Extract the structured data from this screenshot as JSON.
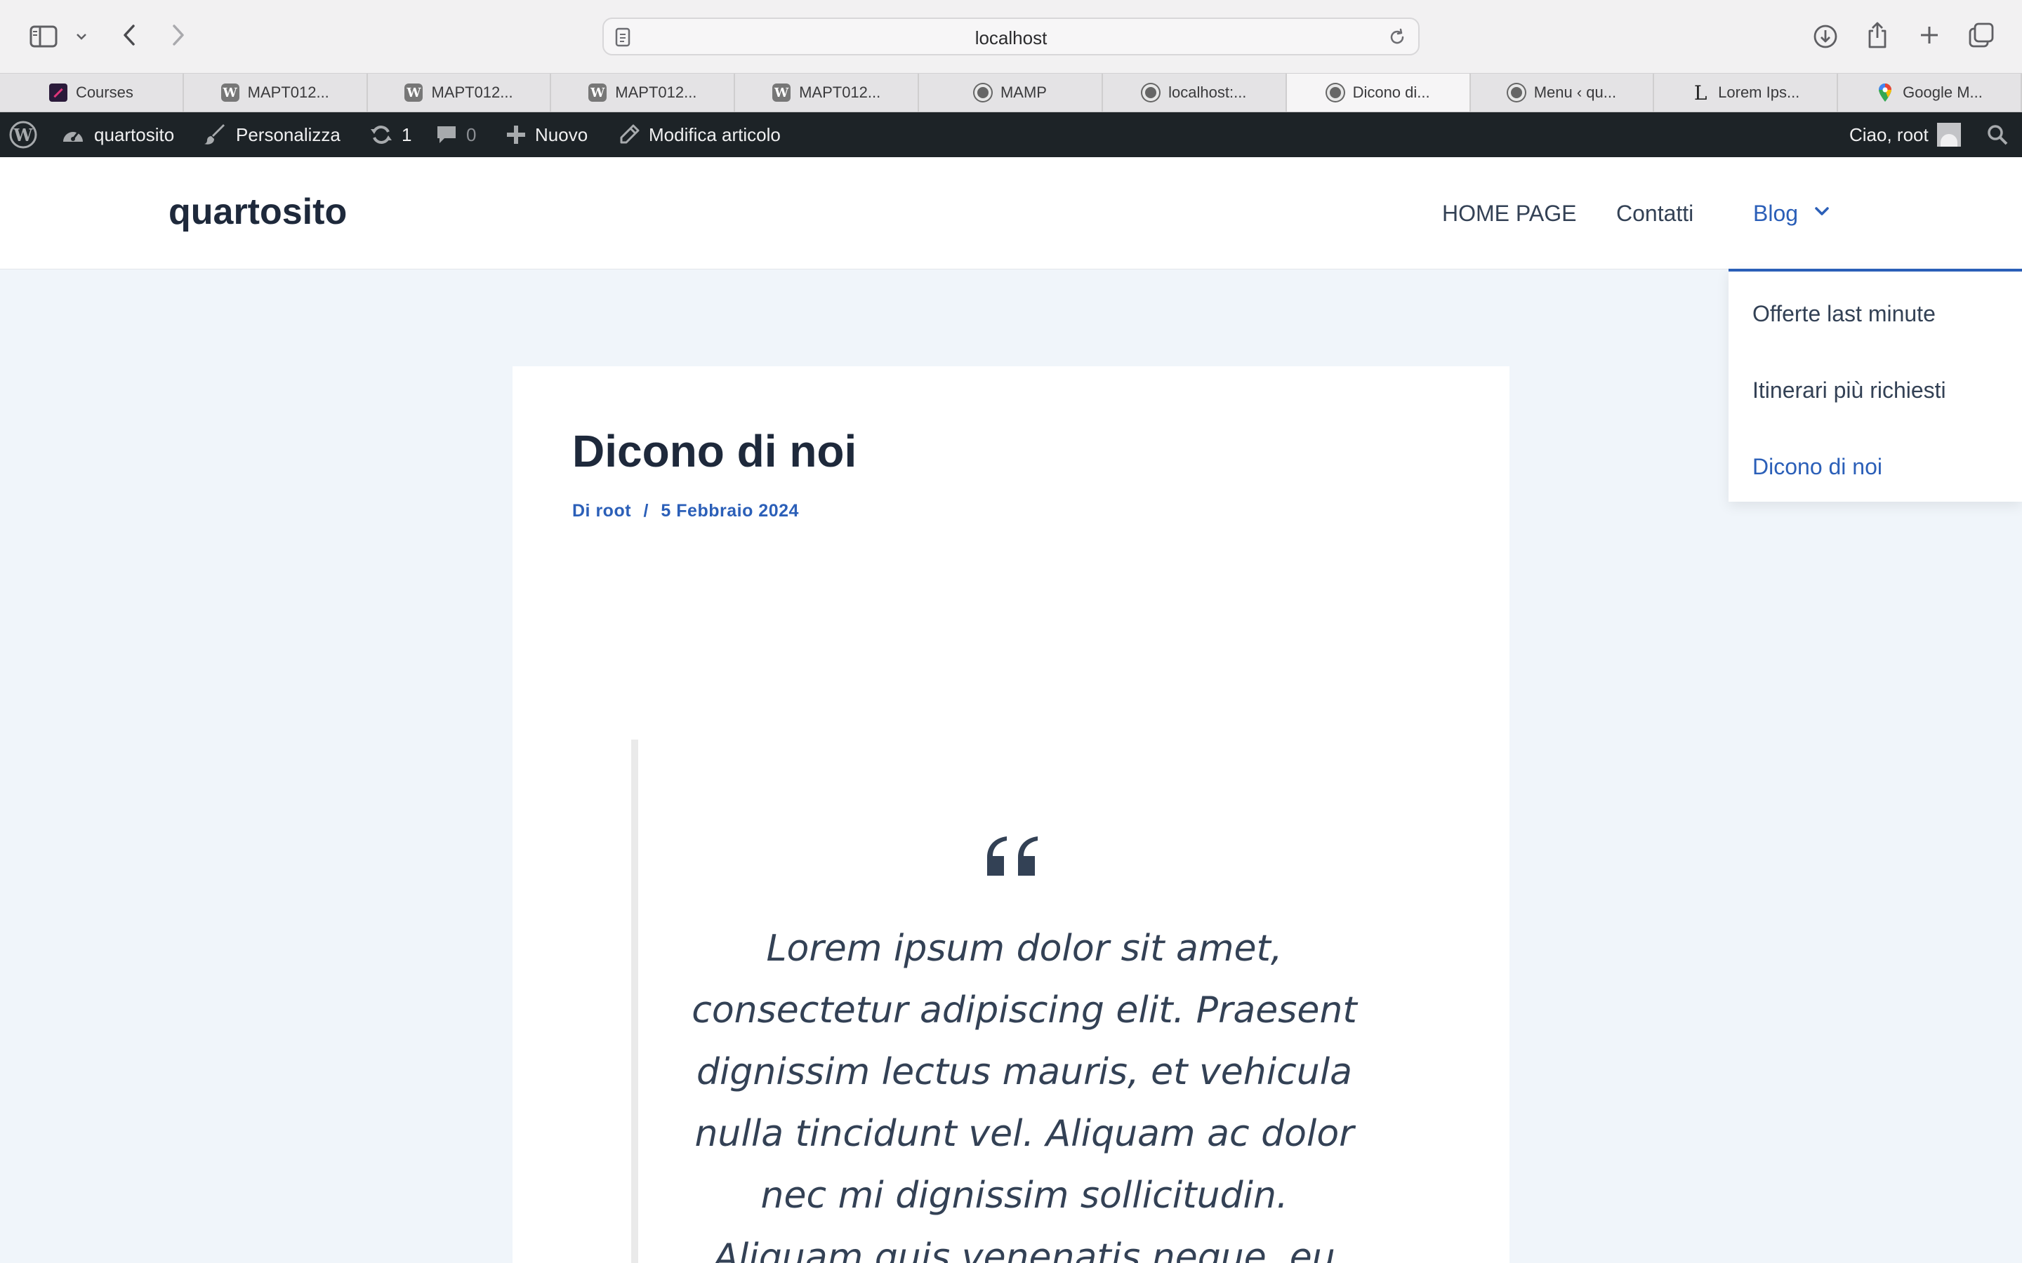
{
  "browser": {
    "url": "localhost",
    "tabs": [
      {
        "label": "Courses",
        "favicon": "courses-logo"
      },
      {
        "label": "MAPT012...",
        "favicon": "wordpress-logo"
      },
      {
        "label": "MAPT012...",
        "favicon": "wordpress-logo"
      },
      {
        "label": "MAPT012...",
        "favicon": "wordpress-logo"
      },
      {
        "label": "MAPT012...",
        "favicon": "wordpress-logo"
      },
      {
        "label": "MAMP",
        "favicon": "mamp-logo"
      },
      {
        "label": "localhost:...",
        "favicon": "mamp-logo"
      },
      {
        "label": "Dicono di...",
        "favicon": "mamp-logo",
        "active": true
      },
      {
        "label": "Menu ‹ qu...",
        "favicon": "mamp-logo"
      },
      {
        "label": "Lorem Ips...",
        "favicon": "lorem-logo"
      },
      {
        "label": "Google M...",
        "favicon": "google-maps-logo"
      }
    ]
  },
  "adminbar": {
    "site_name": "quartosito",
    "customize": "Personalizza",
    "updates_count": "1",
    "comments_count": "0",
    "new": "Nuovo",
    "edit_post": "Modifica articolo",
    "greeting": "Ciao, root"
  },
  "site": {
    "title": "quartosito",
    "nav": {
      "home": "HOME PAGE",
      "contacts": "Contatti",
      "blog": "Blog"
    },
    "submenu": [
      "Offerte last minute",
      "Itinerari più richiesti",
      "Dicono di noi"
    ]
  },
  "post": {
    "title": "Dicono di noi",
    "meta_prefix": "Di",
    "author": "root",
    "separator": "/",
    "date": "5 Febbraio 2024",
    "quote_mark": "“",
    "quote_lines": [
      "Lorem ipsum dolor sit amet,",
      "consectetur adipiscing elit. Praesent",
      "dignissim lectus mauris, et vehicula",
      "nulla tincidunt vel. Aliquam ac dolor",
      "nec mi dignissim sollicitudin.",
      "Aliquam quis venenatis neque, eu"
    ]
  },
  "colors": {
    "accent": "#2b5fb8",
    "adminbar": "#1d2327",
    "page_bg": "#f0f5fa",
    "text_dark": "#1e293b"
  }
}
